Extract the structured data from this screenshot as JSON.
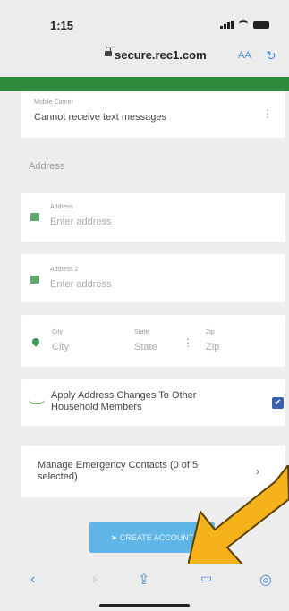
{
  "status": {
    "time": "1:15"
  },
  "browser": {
    "url": "secure.rec1.com",
    "aa_label": "AA"
  },
  "mobile_carrier": {
    "label": "Mobile Carrier",
    "value": "Cannot receive text messages"
  },
  "address_section": {
    "title": "Address"
  },
  "address1": {
    "label": "Address",
    "placeholder": "Enter address"
  },
  "address2": {
    "label": "Address 2",
    "placeholder": "Enter address"
  },
  "city": {
    "label": "City",
    "placeholder": "City"
  },
  "state": {
    "label": "State",
    "placeholder": "State"
  },
  "zip": {
    "label": "Zip",
    "placeholder": "Zip"
  },
  "apply_changes": {
    "label": "Apply Address Changes To Other Household Members",
    "checked": true
  },
  "emergency": {
    "label": "Manage Emergency Contacts (0 of 5 selected)"
  },
  "create_account": {
    "label": "CREATE ACCOUNT"
  },
  "colors": {
    "brand_green": "#2e8b3e",
    "button_blue": "#5fb6e6",
    "arrow_yellow": "#f5b21a"
  }
}
